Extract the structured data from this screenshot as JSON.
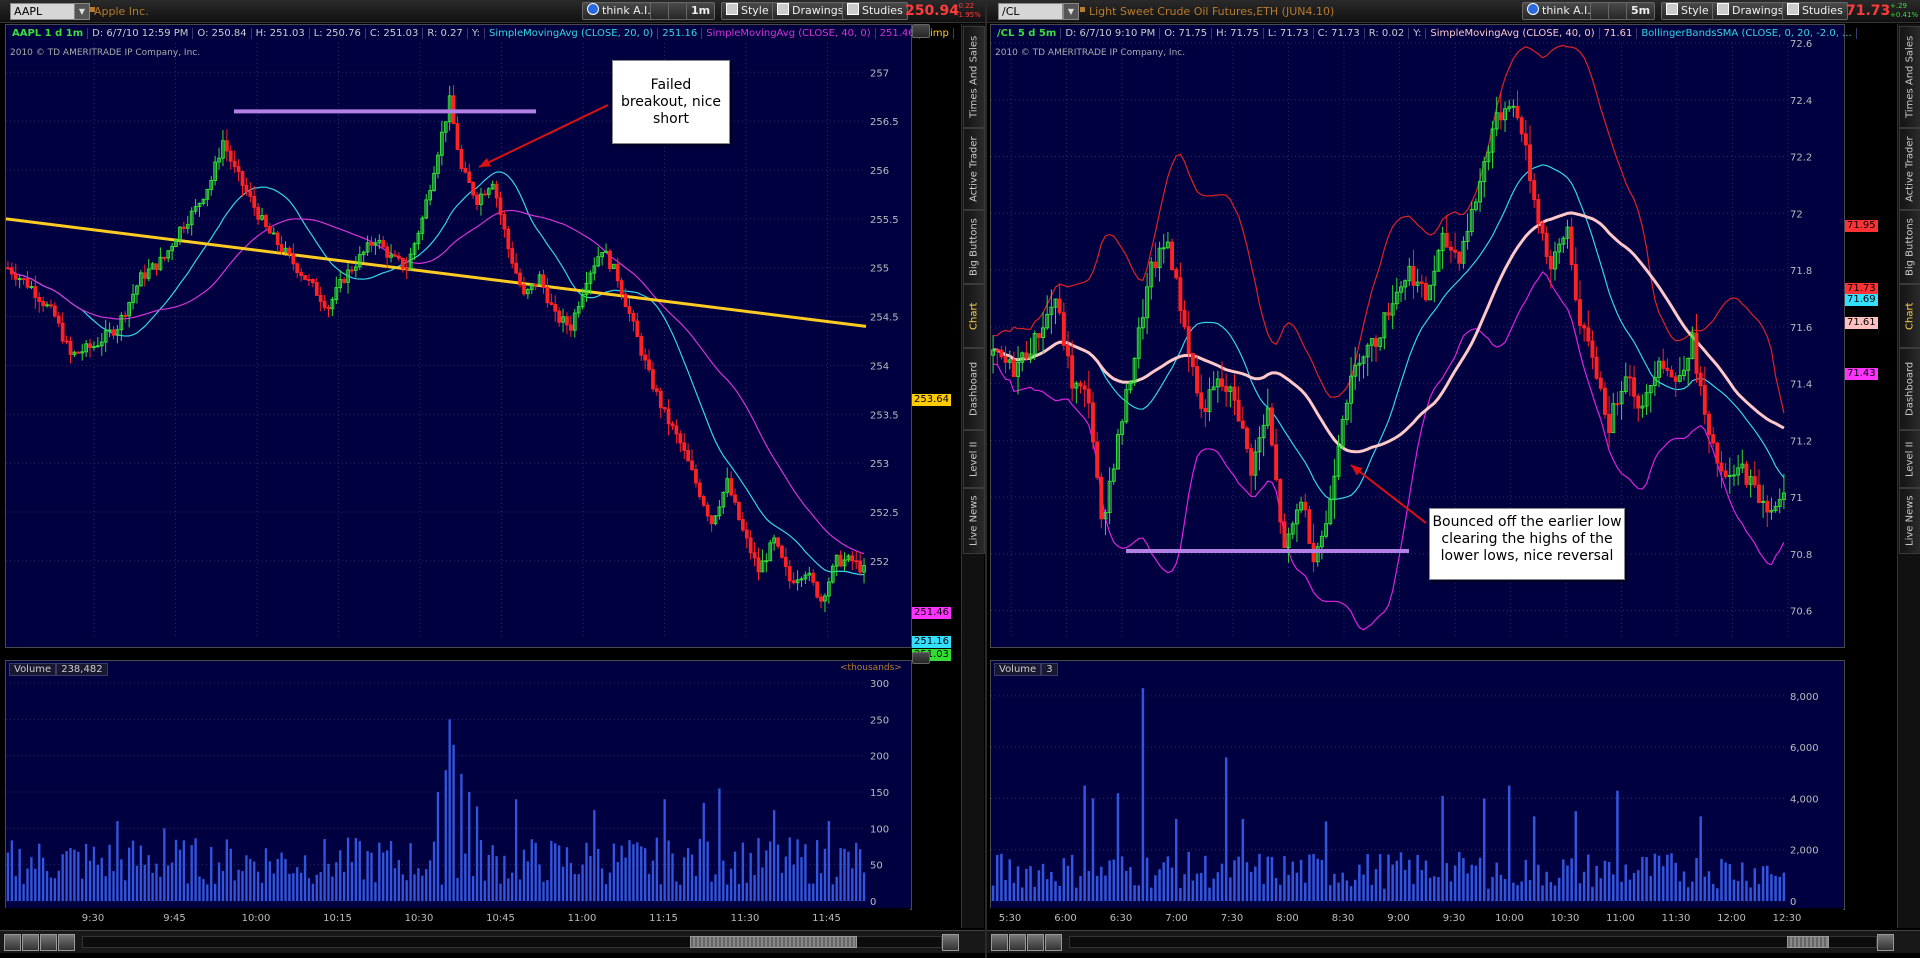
{
  "left": {
    "symbol": "AAPL",
    "company": "Apple Inc.",
    "buttons": [
      "think A.I.",
      "1m",
      "Style",
      "Drawings",
      "Studies"
    ],
    "price": "250.94",
    "price_change": [
      "-0.22",
      "-1.95%"
    ],
    "header": [
      "AAPL 1 d 1m",
      "D: 6/7/10 12:59 PM",
      "O: 250.84",
      "H: 251.03",
      "L: 250.76",
      "C: 251.03",
      "R: 0.27",
      "Y:",
      "SimpleMovingAvg (CLOSE, 20, 0)",
      "251.16",
      "SimpleMovingAvg (CLOSE, 40, 0)",
      "251.46",
      "Simp"
    ],
    "copyright": "2010 © TD AMERITRADE IP Company, Inc.",
    "annotation": [
      "Failed",
      "breakout, nice",
      "short"
    ],
    "volume_label": "Volume",
    "volume_value": "238,482",
    "thousands": "<thousands>",
    "price_tags": [
      {
        "text": "253.64",
        "value": 253.64,
        "color": "#ffcc00"
      },
      {
        "text": "251.46",
        "value": 251.46,
        "color": "#ff33ff"
      },
      {
        "text": "251.16",
        "value": 251.16,
        "color": "#33e0ff"
      },
      {
        "text": "251.03",
        "value": 251.03,
        "color": "#33dd33"
      }
    ],
    "side_tabs": [
      "Times And Sales",
      "Active Trader",
      "Big Buttons",
      "Chart",
      "Dashboard",
      "Level II",
      "Live News"
    ],
    "colors": {
      "sma20": "#33d6e6",
      "sma40": "#d633d6",
      "sma200": "#ffcc22",
      "up": "#33dd33",
      "down": "#ff2222",
      "resistance": "#b380e6",
      "volume": "#3355dd"
    }
  },
  "right": {
    "symbol": "/CL",
    "company": "Light Sweet Crude Oil Futures,ETH (JUN4.10)",
    "buttons": [
      "think A.I.",
      "5m",
      "Style",
      "Drawings",
      "Studies"
    ],
    "price": "71.73",
    "price_change": [
      "+.29",
      "+0.41%"
    ],
    "header": [
      "/CL 5 d 5m",
      "D: 6/7/10 9:10 PM",
      "O: 71.75",
      "H: 71.75",
      "L: 71.73",
      "C: 71.73",
      "R: 0.02",
      "Y:",
      "SimpleMovingAvg (CLOSE, 40, 0)",
      "71.61",
      "BollingerBandsSMA (CLOSE, 0, 20, -2.0, ..."
    ],
    "copyright": "2010 © TD AMERITRADE IP Company, Inc.",
    "annotation": [
      "Bounced off the earlier low",
      "clearing the highs of the",
      "lower lows, nice reversal"
    ],
    "volume_label": "Volume",
    "volume_value": "3",
    "price_tags": [
      {
        "text": "71.95",
        "value": 71.95,
        "color": "#ff3333"
      },
      {
        "text": "71.73",
        "value": 71.73,
        "color": "#ff3333"
      },
      {
        "text": "71.69",
        "value": 71.69,
        "color": "#33e0ff"
      },
      {
        "text": "71.61",
        "value": 71.61,
        "color": "#ffc0c0"
      },
      {
        "text": "71.43",
        "value": 71.43,
        "color": "#ff33ff"
      }
    ],
    "side_tabs": [
      "Times And Sales",
      "Active Trader",
      "Big Buttons",
      "Chart",
      "Dashboard",
      "Level II",
      "Live News"
    ],
    "colors": {
      "upper_band": "#dd2222",
      "lower_band": "#dd22dd",
      "mid_band": "#33d6e6",
      "sma40": "#ffc8c8",
      "up": "#33dd33",
      "down": "#ff2222",
      "support": "#b380e6",
      "volume": "#3355dd"
    }
  },
  "chart_data": [
    {
      "type": "candlestick",
      "title": "AAPL 1 d 1m",
      "y_ticks": [
        "257",
        "256.5",
        "256",
        "255.5",
        "255",
        "254.5",
        "254",
        "253.5",
        "253",
        "252.5",
        "252"
      ],
      "ylim": [
        251.2,
        257.3
      ],
      "x_ticks": [
        "9:30",
        "9:45",
        "10:00",
        "10:15",
        "10:30",
        "10:45",
        "11:00",
        "11:15",
        "11:30",
        "11:45"
      ],
      "volume_ticks": [
        "300",
        "250",
        "200",
        "150",
        "100",
        "50",
        "0"
      ],
      "volume_ylim": [
        0,
        300
      ],
      "resistance_level": 256.6,
      "close_path": [
        [
          0,
          255.0
        ],
        [
          6,
          254.8
        ],
        [
          12,
          254.5
        ],
        [
          16,
          254.1
        ],
        [
          22,
          254.2
        ],
        [
          28,
          254.4
        ],
        [
          34,
          254.9
        ],
        [
          40,
          255.1
        ],
        [
          44,
          255.4
        ],
        [
          48,
          255.6
        ],
        [
          52,
          255.9
        ],
        [
          55,
          256.3
        ],
        [
          58,
          256.0
        ],
        [
          62,
          255.7
        ],
        [
          66,
          255.4
        ],
        [
          70,
          255.2
        ],
        [
          74,
          255.0
        ],
        [
          78,
          254.8
        ],
        [
          82,
          254.6
        ],
        [
          86,
          254.9
        ],
        [
          90,
          255.1
        ],
        [
          94,
          255.3
        ],
        [
          98,
          255.1
        ],
        [
          102,
          255.0
        ],
        [
          106,
          255.5
        ],
        [
          110,
          256.2
        ],
        [
          113,
          256.7
        ],
        [
          116,
          256.0
        ],
        [
          120,
          255.7
        ],
        [
          124,
          255.9
        ],
        [
          128,
          255.2
        ],
        [
          132,
          254.7
        ],
        [
          136,
          254.9
        ],
        [
          140,
          254.5
        ],
        [
          144,
          254.4
        ],
        [
          148,
          254.9
        ],
        [
          152,
          255.2
        ],
        [
          156,
          254.9
        ],
        [
          160,
          254.4
        ],
        [
          164,
          253.9
        ],
        [
          168,
          253.5
        ],
        [
          172,
          253.2
        ],
        [
          176,
          252.8
        ],
        [
          180,
          252.4
        ],
        [
          184,
          252.8
        ],
        [
          188,
          252.3
        ],
        [
          192,
          251.9
        ],
        [
          196,
          252.2
        ],
        [
          200,
          251.8
        ],
        [
          204,
          251.9
        ],
        [
          208,
          251.6
        ],
        [
          212,
          252.0
        ],
        [
          216,
          252.0
        ],
        [
          219,
          251.9
        ]
      ],
      "sma200_values": [
        255.5,
        254.4
      ]
    },
    {
      "type": "candlestick",
      "title": "/CL 5 d 5m",
      "y_ticks": [
        "72.6",
        "72.4",
        "72.2",
        "72",
        "71.8",
        "71.6",
        "71.4",
        "71.2",
        "71",
        "70.8",
        "70.6"
      ],
      "ylim": [
        70.5,
        72.6
      ],
      "x_ticks": [
        "5:30",
        "6:00",
        "6:30",
        "7:00",
        "7:30",
        "8:00",
        "8:30",
        "9:00",
        "9:30",
        "10:00",
        "10:30",
        "11:00",
        "11:30",
        "12:00",
        "12:30"
      ],
      "volume_ticks": [
        "8,000",
        "6,000",
        "4,000",
        "2,000",
        "0"
      ],
      "volume_ylim": [
        0,
        8500
      ],
      "support_level": 70.81,
      "close_path": [
        [
          0,
          71.5
        ],
        [
          5,
          71.45
        ],
        [
          10,
          71.55
        ],
        [
          15,
          71.7
        ],
        [
          19,
          71.4
        ],
        [
          23,
          71.35
        ],
        [
          26,
          70.9
        ],
        [
          30,
          71.2
        ],
        [
          34,
          71.5
        ],
        [
          38,
          71.8
        ],
        [
          42,
          71.9
        ],
        [
          46,
          71.6
        ],
        [
          50,
          71.3
        ],
        [
          54,
          71.4
        ],
        [
          58,
          71.35
        ],
        [
          62,
          71.1
        ],
        [
          66,
          71.3
        ],
        [
          70,
          70.8
        ],
        [
          74,
          71.0
        ],
        [
          77,
          70.8
        ],
        [
          80,
          70.9
        ],
        [
          84,
          71.3
        ],
        [
          88,
          71.5
        ],
        [
          92,
          71.55
        ],
        [
          96,
          71.7
        ],
        [
          100,
          71.8
        ],
        [
          104,
          71.7
        ],
        [
          108,
          71.9
        ],
        [
          112,
          71.85
        ],
        [
          116,
          72.05
        ],
        [
          120,
          72.3
        ],
        [
          124,
          72.4
        ],
        [
          127,
          72.3
        ],
        [
          130,
          72.05
        ],
        [
          134,
          71.8
        ],
        [
          138,
          71.95
        ],
        [
          141,
          71.6
        ],
        [
          144,
          71.5
        ],
        [
          148,
          71.25
        ],
        [
          152,
          71.45
        ],
        [
          156,
          71.3
        ],
        [
          160,
          71.5
        ],
        [
          164,
          71.4
        ],
        [
          168,
          71.55
        ],
        [
          172,
          71.2
        ],
        [
          176,
          71.05
        ],
        [
          180,
          71.1
        ],
        [
          184,
          71.0
        ],
        [
          188,
          70.95
        ],
        [
          190,
          71.0
        ]
      ]
    }
  ]
}
